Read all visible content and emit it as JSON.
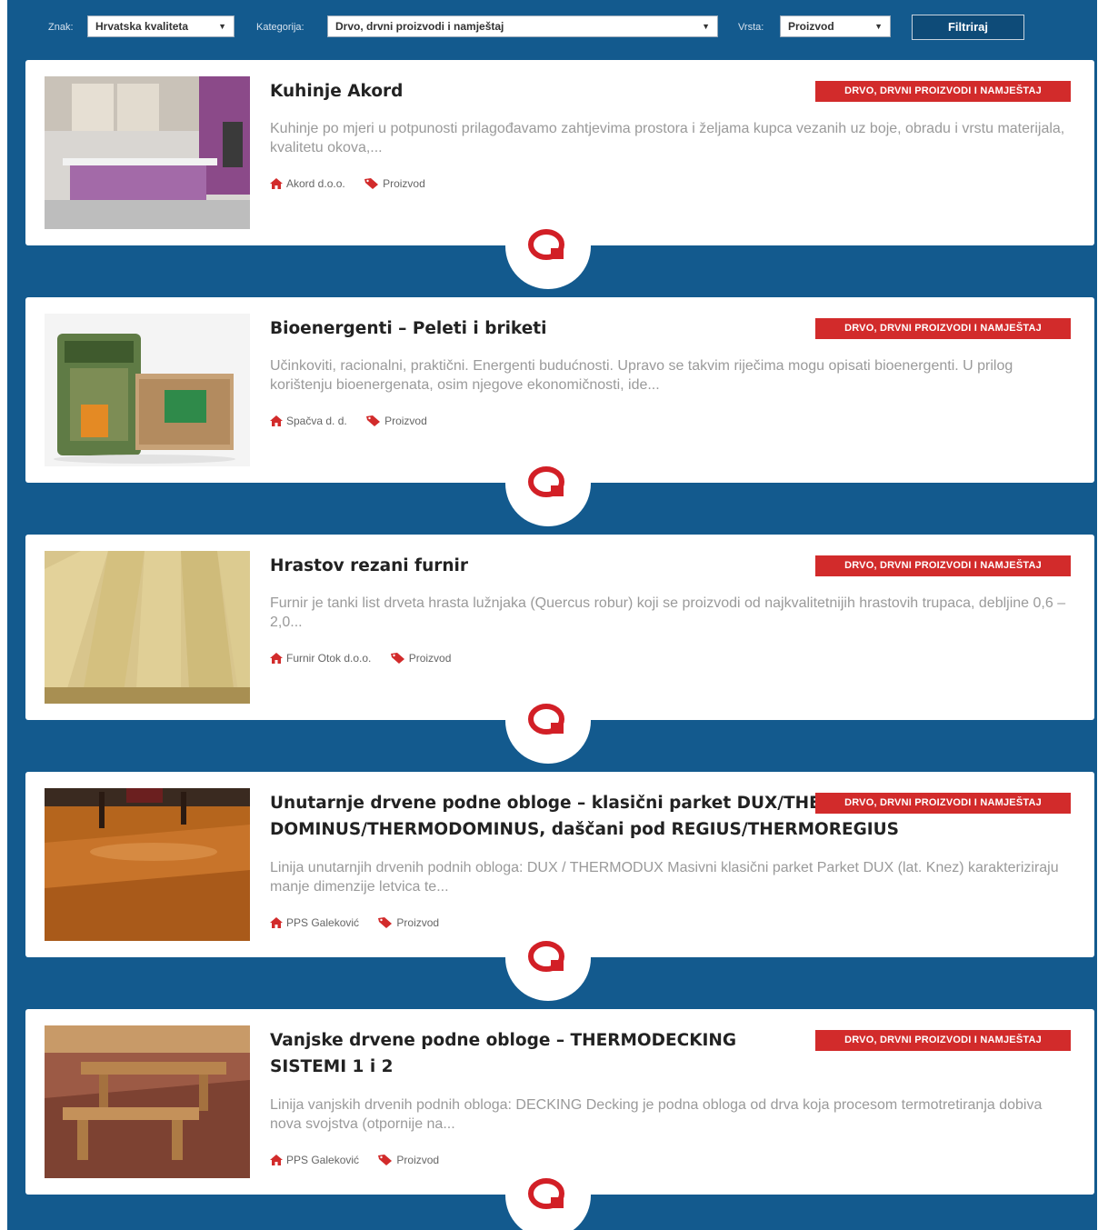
{
  "filters": {
    "znak": {
      "label": "Znak:",
      "value": "Hrvatska kvaliteta"
    },
    "kategorija": {
      "label": "Kategorija:",
      "value": "Drvo, drvni proizvodi i namještaj"
    },
    "vrsta": {
      "label": "Vrsta:",
      "value": "Proizvod"
    },
    "submit_label": "Filtriraj"
  },
  "items": [
    {
      "title": "Kuhinje Akord",
      "badge": "DRVO, DRVNI PROIZVODI I NAMJEŠTAJ",
      "description": "Kuhinje po mjeri u potpunosti prilagođavamo zahtjevima prostora i željama kupca vezanih uz boje, obradu i vrstu materijala, kvalitetu  okova,...",
      "company": "Akord d.o.o.",
      "type": "Proizvod",
      "image": "kitchen-photo"
    },
    {
      "title": "Bioenergenti – Peleti i briketi",
      "badge": "DRVO, DRVNI PROIZVODI I NAMJEŠTAJ",
      "description": "Učinkoviti, racionalni, praktični. Energenti budućnosti. Upravo se takvim riječima mogu opisati bioenergenti. U prilog korištenju bioenergenata, osim njegove ekonomičnosti, ide...",
      "company": "Spačva d. d.",
      "type": "Proizvod",
      "image": "pellets-photo"
    },
    {
      "title": "Hrastov rezani furnir",
      "badge": "DRVO, DRVNI PROIZVODI I NAMJEŠTAJ",
      "description": "Furnir je tanki list drveta hrasta lužnjaka (Quercus robur) koji se proizvodi od najkvalitetnijih hrastovih trupaca, debljine 0,6 – 2,0...",
      "company": "Furnir Otok d.o.o.",
      "type": "Proizvod",
      "image": "veneer-photo"
    },
    {
      "title": "Unutarnje drvene podne obloge – klasični parket DUX/THERMODUX, DOMINUS/THERMODOMINUS, daščani pod REGIUS/THERMOREGIUS",
      "badge": "DRVO, DRVNI PROIZVODI I NAMJEŠTAJ",
      "description": "Linija unutarnjih drvenih podnih obloga: DUX / THERMODUX Masivni klasični parket Parket DUX (lat. Knez) karakteriziraju manje dimenzije letvica te...",
      "company": "PPS Galeković",
      "type": "Proizvod",
      "image": "parquet-photo"
    },
    {
      "title": "Vanjske drvene podne obloge – THERMODECKING SISTEMI 1 i 2",
      "badge": "DRVO, DRVNI PROIZVODI I NAMJEŠTAJ",
      "description": "Linija vanjskih drvenih podnih obloga: DECKING Decking je podna obloga od drva koja procesom termotretiranja dobiva nova svojstva (otpornije na...",
      "company": "PPS Galeković",
      "type": "Proizvod",
      "image": "decking-photo"
    }
  ],
  "colors": {
    "background": "#135a8e",
    "accent": "#d22b2b",
    "card": "#ffffff"
  },
  "icons": {
    "company": "home-icon",
    "type": "tag-icon",
    "more": "quality-q-logo-icon"
  }
}
